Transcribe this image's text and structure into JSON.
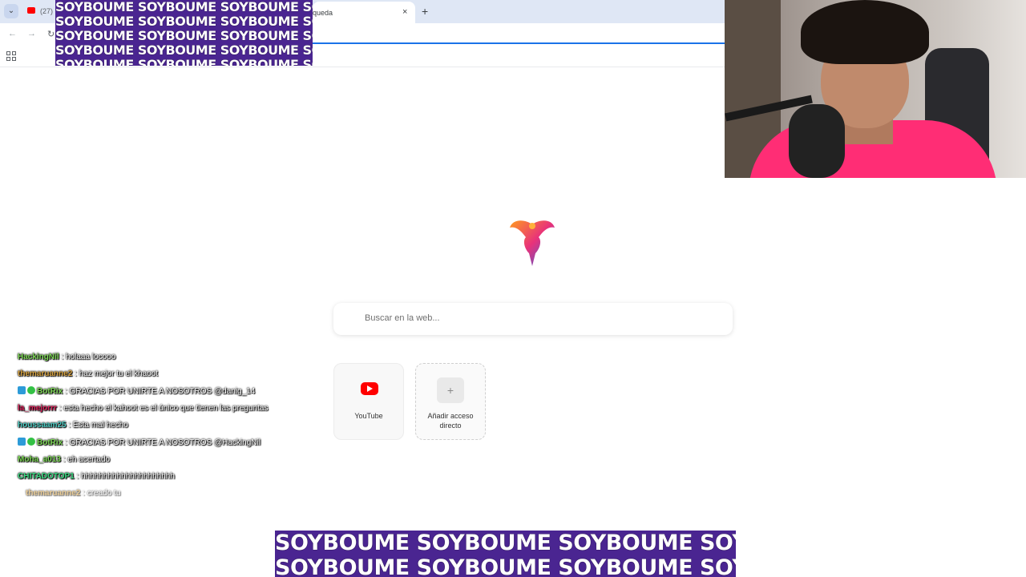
{
  "browser": {
    "tabs": [
      {
        "label": "(27)",
        "icon": "youtube-icon"
      },
      {
        "label": "queda",
        "active": true
      }
    ],
    "close_glyph": "×",
    "new_tab_glyph": "+",
    "tab_menu_glyph": "⌄",
    "back_glyph": "←",
    "forward_glyph": "→",
    "reload_glyph": "↻"
  },
  "overlay_banner": {
    "text": "SOYBOUME SOYBOUME SOYBOUME SOYBOUME"
  },
  "page": {
    "logo_icon": "phoenix-logo",
    "search_placeholder": "Buscar en la web...",
    "shortcuts": [
      {
        "label": "YouTube",
        "icon": "youtube-icon"
      },
      {
        "label": "Añadir acceso directo",
        "icon": "plus-icon",
        "glyph": "+"
      }
    ]
  },
  "chat": {
    "messages": [
      {
        "user": "HackingNil",
        "text": ": holaaa locooo",
        "color": "#7ed957",
        "badges": []
      },
      {
        "user": "themaruanne2",
        "text": ": haz mejor tu el khaoot",
        "color": "#d9a441",
        "badges": []
      },
      {
        "user": "BotRix",
        "text": ": GRACIAS POR UNIRTE A NOSOTROS @danig_14",
        "color": "#7ed957",
        "badges": [
          "mod",
          "verified"
        ]
      },
      {
        "user": "la_mejorrr",
        "text": ": esta hecho el kahoot es el único que tienen las preguntas",
        "color": "#e0245e",
        "badges": []
      },
      {
        "user": "houssaam25",
        "text": ": Esta mal hecho",
        "color": "#4ecdc4",
        "badges": []
      },
      {
        "user": "BotRix",
        "text": ": GRACIAS POR UNIRTE A NOSOTROS @HackingNil",
        "color": "#7ed957",
        "badges": [
          "mod",
          "verified"
        ]
      },
      {
        "user": "Moha_a013",
        "text": ": eh acertado",
        "color": "#7ed957",
        "badges": []
      },
      {
        "user": "CHITADOTOP1",
        "text": ": hhhhhhhhhhhhhhhhhhhhh",
        "color": "#3ddc84",
        "badges": []
      },
      {
        "user": "themaruanne2",
        "text": ": creado tu",
        "color": "#d9a441",
        "badges": [],
        "faded": true
      }
    ]
  }
}
